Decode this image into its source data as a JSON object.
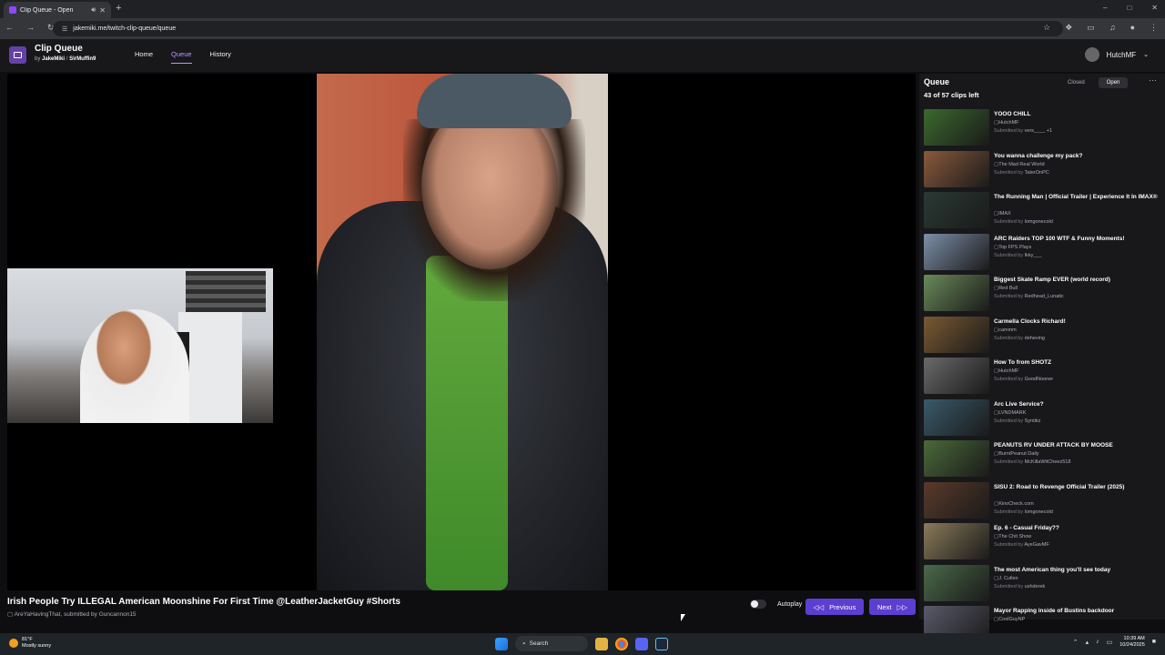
{
  "browser": {
    "tab_title": "Clip Queue - Open",
    "url": "jakemiki.me/twitch-clip-queue/queue"
  },
  "app": {
    "title": "Clip Queue",
    "by_label": "by",
    "author1": "JakeMiki",
    "separator": "/",
    "author2": "SirMuffin9",
    "nav": [
      "Home",
      "Queue",
      "History"
    ],
    "user": "HutchMF"
  },
  "player": {
    "clip_title": "Irish People Try ILLEGAL American Moonshine For First Time @LeatherJacketGuy #Shorts",
    "channel": "AreYaHavingThat",
    "submitted_by_label": ", submitted by",
    "submitter": "Guncannon15",
    "autoplay_label": "Autoplay",
    "prev_label": "Previous",
    "next_label": "Next"
  },
  "queue": {
    "title": "Queue",
    "count": "43 of 57 clips left",
    "closed_label": "Closed",
    "open_label": "Open",
    "items": [
      {
        "title": "YOOO CHILL",
        "channel": "HutchMF",
        "submitter": "vers____ +1",
        "thumb": "#3c6a2e"
      },
      {
        "title": "You wanna challenge my pack?",
        "channel": "The Mad Real World",
        "submitter": "TaterOnPC",
        "thumb": "#8a5a3c"
      },
      {
        "title": "The Running Man | Official Trailer | Experience It In IMAX®",
        "channel": "IMAX",
        "submitter": "lomgonecold",
        "thumb": "#2a3a34"
      },
      {
        "title": "ARC Raiders TOP 100 WTF & Funny Moments!",
        "channel": "Top FPS Plays",
        "submitter": "Ikky___",
        "thumb": "#7d8fa8"
      },
      {
        "title": "Biggest Skate Ramp EVER (world record)",
        "channel": "Red Bull",
        "submitter": "Redhead_Lunatic",
        "thumb": "#6a8a5a"
      },
      {
        "title": "Carmella Clocks Richard!",
        "channel": "cammm",
        "submitter": "deheving",
        "thumb": "#7a5a32"
      },
      {
        "title": "How To from SHOTZ",
        "channel": "HutchMF",
        "submitter": "GoodNooner",
        "thumb": "#6a6a6a"
      },
      {
        "title": "Arc Live Service?",
        "channel": "LVNDMARK",
        "submitter": "Syntikz",
        "thumb": "#3a5a6a"
      },
      {
        "title": "PEANUTS RV UNDER ATTACK BY MOOSE",
        "channel": "BurntPeanut Daily",
        "submitter": "McKillaWitCheez518",
        "thumb": "#4a6a3a"
      },
      {
        "title": "SISU 2: Road to Revenge Official Trailer (2025)",
        "channel": "KinoCheck.com",
        "submitter": "lomgonecold",
        "thumb": "#5a3a2a"
      },
      {
        "title": "Ep. 6 - Casual Friday??",
        "channel": "The Chit Show",
        "submitter": "AyeGavMF",
        "thumb": "#8a7a5a"
      },
      {
        "title": "The most American thing you'll see today",
        "channel": "J. Cullen",
        "submitter": "ushderek",
        "thumb": "#4a6a4a"
      },
      {
        "title": "Mayor Rapping inside of Bustins backdoor",
        "channel": "CoolGuyNP",
        "submitter": "",
        "thumb": "#5a5a6a"
      }
    ],
    "channel_prefix": "",
    "submitted_prefix": "Submitted by"
  },
  "taskbar": {
    "temp": "81°F",
    "weather": "Mostly sunny",
    "search": "Search",
    "time": "10:39 AM",
    "date": "10/24/2025"
  }
}
